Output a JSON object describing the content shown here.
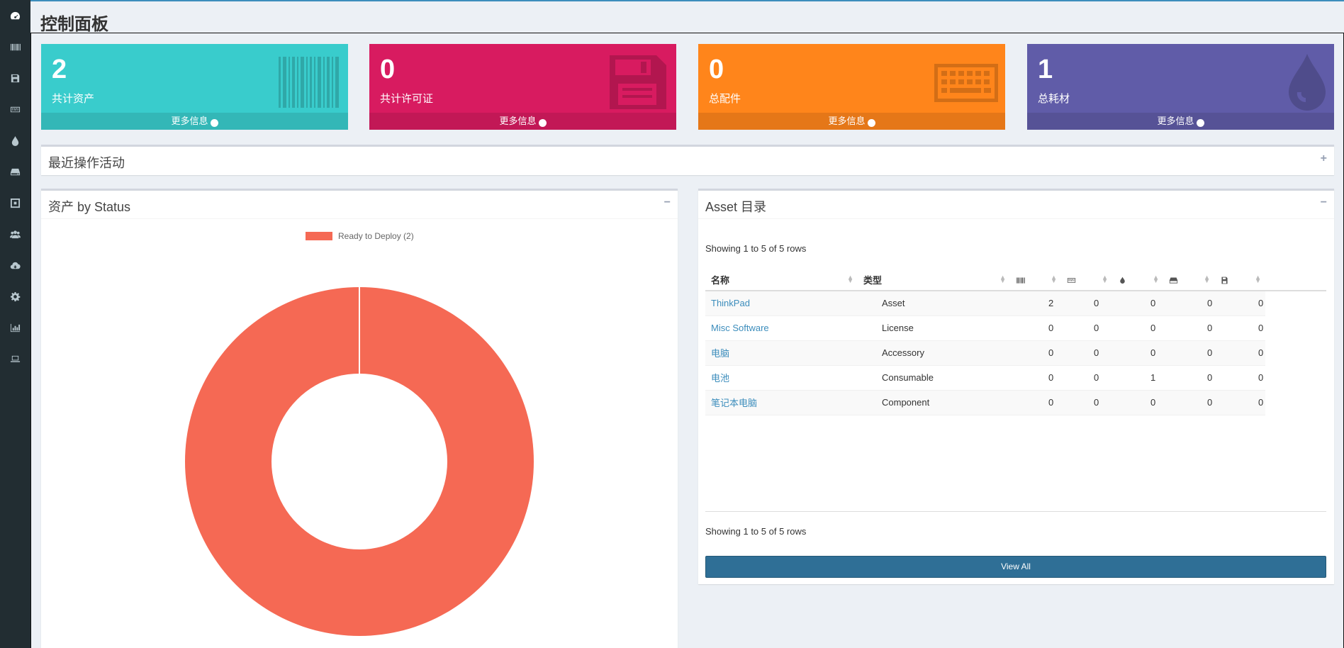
{
  "page": {
    "title": "控制面板"
  },
  "sidebar": {
    "items": [
      {
        "icon": "dashboard-icon"
      },
      {
        "icon": "barcode-icon"
      },
      {
        "icon": "floppy-disk-icon"
      },
      {
        "icon": "keyboard-icon"
      },
      {
        "icon": "tint-icon"
      },
      {
        "icon": "hard-drive-icon"
      },
      {
        "icon": "crosshairs-icon"
      },
      {
        "icon": "users-icon"
      },
      {
        "icon": "cloud-download-icon"
      },
      {
        "icon": "cog-icon"
      },
      {
        "icon": "bar-chart-icon"
      },
      {
        "icon": "laptop-icon"
      }
    ]
  },
  "tiles": [
    {
      "count": "2",
      "label": "共计资产",
      "link": "更多信息",
      "icon": "barcode-icon",
      "color": "#39cccc"
    },
    {
      "count": "0",
      "label": "共计许可证",
      "link": "更多信息",
      "icon": "floppy-disk-icon",
      "color": "#d81b60"
    },
    {
      "count": "0",
      "label": "总配件",
      "link": "更多信息",
      "icon": "keyboard-icon",
      "color": "#ff851b"
    },
    {
      "count": "1",
      "label": "总耗材",
      "link": "更多信息",
      "icon": "tint-icon",
      "color": "#605ca8"
    }
  ],
  "recent_activity": {
    "title": "最近操作活动",
    "toggle": "+"
  },
  "status_box": {
    "title": "资产 by Status",
    "toggle": "−",
    "legend": "Ready to Deploy (2)"
  },
  "chart_data": {
    "type": "pie",
    "title": "",
    "categories": [
      "Ready to Deploy"
    ],
    "values": [
      2
    ],
    "colors": [
      "#f56954"
    ],
    "legend_position": "top"
  },
  "catalog_box": {
    "title": "Asset 目录",
    "toggle": "−",
    "showing_top": "Showing 1 to 5 of 5 rows",
    "showing_bottom": "Showing 1 to 5 of 5 rows",
    "columns": [
      "名称",
      "类型"
    ],
    "icon_columns": [
      "barcode-icon",
      "keyboard-icon",
      "tint-icon",
      "hard-drive-icon",
      "floppy-disk-icon"
    ],
    "rows": [
      {
        "name": "ThinkPad",
        "type": "Asset",
        "c1": "2",
        "c2": "0",
        "c3": "0",
        "c4": "0",
        "c5": "0"
      },
      {
        "name": "Misc Software",
        "type": "License",
        "c1": "0",
        "c2": "0",
        "c3": "0",
        "c4": "0",
        "c5": "0"
      },
      {
        "name": "电脑",
        "type": "Accessory",
        "c1": "0",
        "c2": "0",
        "c3": "0",
        "c4": "0",
        "c5": "0"
      },
      {
        "name": "电池",
        "type": "Consumable",
        "c1": "0",
        "c2": "0",
        "c3": "1",
        "c4": "0",
        "c5": "0"
      },
      {
        "name": "笔记本电脑",
        "type": "Component",
        "c1": "0",
        "c2": "0",
        "c3": "0",
        "c4": "0",
        "c5": "0"
      }
    ],
    "view_all": "View All"
  }
}
